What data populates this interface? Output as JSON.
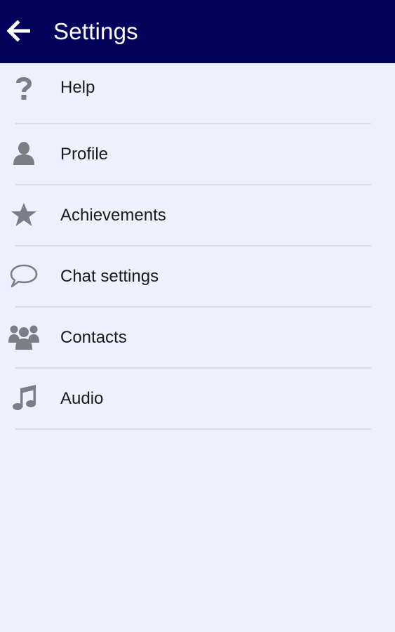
{
  "header": {
    "title": "Settings",
    "back_icon": "arrow-left-icon"
  },
  "colors": {
    "app_bar": "#03035c",
    "background": "#eef0fd",
    "icon": "#7d7d85",
    "divider": "#d9dbe6"
  },
  "settings": {
    "items": [
      {
        "label": "Help",
        "icon": "help-icon"
      },
      {
        "label": "Profile",
        "icon": "profile-icon"
      },
      {
        "label": "Achievements",
        "icon": "star-icon"
      },
      {
        "label": "Chat settings",
        "icon": "chat-bubble-icon"
      },
      {
        "label": "Contacts",
        "icon": "contacts-icon"
      },
      {
        "label": "Audio",
        "icon": "music-note-icon"
      }
    ]
  }
}
